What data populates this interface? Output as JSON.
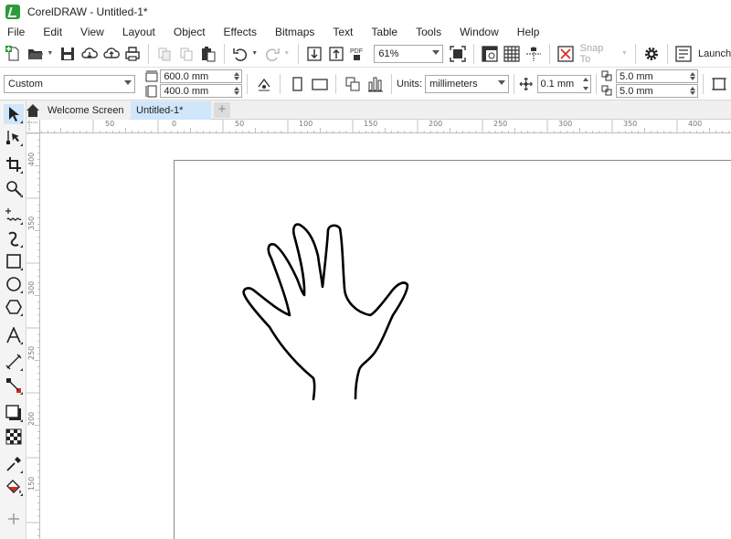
{
  "window": {
    "title": "CorelDRAW - Untitled-1*",
    "accent_color": "#2d9b3a"
  },
  "menu": [
    "File",
    "Edit",
    "View",
    "Layout",
    "Object",
    "Effects",
    "Bitmaps",
    "Text",
    "Table",
    "Tools",
    "Window",
    "Help"
  ],
  "toolbar": {
    "export_pdf_label": "PDF",
    "zoom_value": "61%",
    "snap_to_label": "Snap To",
    "launch_label": "Launch"
  },
  "property_bar": {
    "page_preset": "Custom",
    "page_width": "600.0 mm",
    "page_height": "400.0 mm",
    "units_label": "Units:",
    "units_value": "millimeters",
    "nudge_distance": "0.1 mm",
    "duplicate_x": "5.0 mm",
    "duplicate_y": "5.0 mm"
  },
  "tabs": [
    {
      "label": "Welcome Screen"
    },
    {
      "label": "Untitled-1*"
    }
  ],
  "ruler": {
    "horizontal_labels": [
      "50",
      "0",
      "50",
      "100",
      "150",
      "200",
      "250",
      "300",
      "350",
      "400"
    ],
    "vertical_labels": [
      "400",
      "350",
      "300",
      "250",
      "200",
      "150"
    ]
  },
  "toolbox": [
    "pick-tool-icon",
    "shape-tool-icon",
    "crop-tool-icon",
    "zoom-tool-icon",
    "freehand-tool-icon",
    "artistic-media-tool-icon",
    "rectangle-tool-icon",
    "ellipse-tool-icon",
    "polygon-tool-icon",
    "text-tool-icon",
    "dimension-tool-icon",
    "connector-tool-icon",
    "drop-shadow-tool-icon",
    "transparency-tool-icon",
    "eyedropper-tool-icon",
    "fill-tool-icon",
    "add-tool-icon"
  ]
}
